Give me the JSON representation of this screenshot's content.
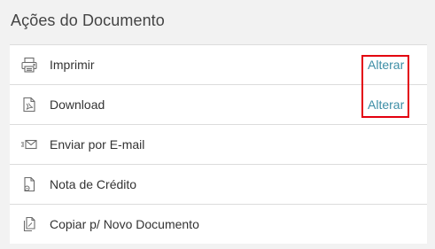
{
  "panel": {
    "title": "Ações do Documento"
  },
  "actions": [
    {
      "label": "Imprimir",
      "icon": "printer-icon",
      "action_label": "Alterar"
    },
    {
      "label": "Download",
      "icon": "pdf-download-icon",
      "action_label": "Alterar"
    },
    {
      "label": "Enviar por E-mail",
      "icon": "email-send-icon"
    },
    {
      "label": "Nota de Crédito",
      "icon": "credit-note-icon"
    },
    {
      "label": "Copiar p/ Novo Documento",
      "icon": "copy-document-icon"
    }
  ],
  "colors": {
    "link": "#3d8ea6",
    "highlight": "#e3000f",
    "background": "#f2f2f2",
    "divider": "#dcdcdc"
  }
}
